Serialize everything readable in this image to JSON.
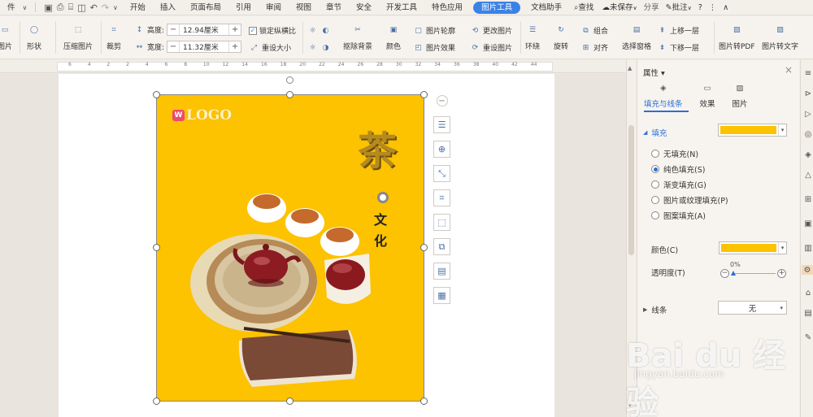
{
  "menu": {
    "file_label": "件",
    "items": [
      "开始",
      "插入",
      "页面布局",
      "引用",
      "审阅",
      "视图",
      "章节",
      "安全",
      "开发工具",
      "特色应用",
      "图片工具",
      "文档助手"
    ],
    "active_item": "图片工具",
    "search_label": "查找",
    "unsaved_label": "未保存",
    "share_label": "分享",
    "annotate_label": "批注",
    "help_label": "?"
  },
  "ribbon": {
    "picture_label": "图片",
    "shape_label": "形状",
    "compress_label": "压缩图片",
    "crop_label": "裁剪",
    "height_label": "高度:",
    "height_value": "12.94厘米",
    "width_label": "宽度:",
    "width_value": "11.32厘米",
    "lock_ratio_label": "锁定纵横比",
    "reset_size_label": "重设大小",
    "remove_bg_label": "抠除背景",
    "color_label": "颜色",
    "outline_label": "图片轮廓",
    "effect_label": "图片效果",
    "change_label": "更改图片",
    "reset_pic_label": "重设图片",
    "wrap_label": "环绕",
    "rotate_label": "旋转",
    "group_label": "组合",
    "align_label": "对齐",
    "select_pane_label": "选择窗格",
    "bring_forward_label": "上移一层",
    "send_backward_label": "下移一层",
    "to_pdf_label": "图片转PDF",
    "to_text_label": "图片转文字"
  },
  "ruler": {
    "ticks": [
      "6",
      "4",
      "2",
      "2",
      "4",
      "6",
      "8",
      "10",
      "12",
      "14",
      "16",
      "18",
      "20",
      "22",
      "24",
      "26",
      "28",
      "30",
      "32",
      "34",
      "36",
      "38",
      "40",
      "42",
      "44"
    ]
  },
  "poster": {
    "logo_mark": "W",
    "logo_text": "LOGO",
    "title_char": "茶",
    "char_wen": "文",
    "char_hua": "化"
  },
  "panel": {
    "title": "属性",
    "tabs": [
      "填充与线条",
      "效果",
      "图片"
    ],
    "fill_section": "填充",
    "fill_options": [
      "无填充(N)",
      "纯色填充(S)",
      "渐变填充(G)",
      "图片或纹理填充(P)",
      "图案填充(A)"
    ],
    "selected_fill": "纯色填充(S)",
    "color_label": "颜色(C)",
    "transparency_label": "透明度(T)",
    "transparency_value": "0%",
    "line_section": "线条",
    "line_value": "无"
  },
  "colors": {
    "accent": "#3b82e6",
    "fill": "#fdc200",
    "tab_active": "#2b6fd6"
  },
  "watermark": {
    "text": "Bai du 经验",
    "url": "jingyan.baidu.com"
  }
}
